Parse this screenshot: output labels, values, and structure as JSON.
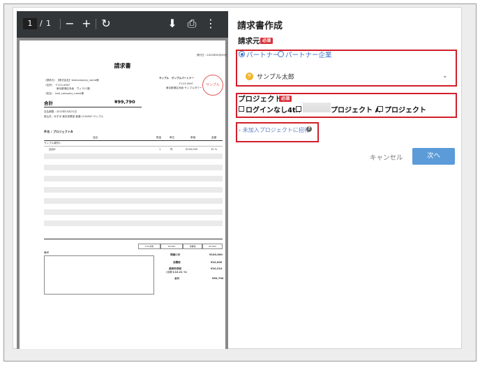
{
  "viewer": {
    "current_page": "1",
    "page_separator": "/",
    "total_pages": "1",
    "zoom_out_icon": "−",
    "zoom_in_icon": "+",
    "rotate_icon": "↻",
    "download_icon": "⬇",
    "print_icon": "⎙",
    "more_icon": "⋮"
  },
  "pdf": {
    "title": "請求書",
    "issue_date": "発行日 : 2022年09月30日",
    "recipient_lines": [
      "（請求元）　【株式会社】testcompany_name様",
      "（住所）　〒123-4567",
      "　　　　　東京都港区赤坂　ヴィラ11階",
      "（宛名）　test_company_name様"
    ],
    "sender_name": "サンプル　サンプルパートナー",
    "sender_lines": [
      "〒123-4567",
      "東京都港区赤坂 サンプルタワー"
    ],
    "seal_text": "サンプル",
    "total_label": "合計",
    "total_value": "¥99,790",
    "due_lines": [
      "支払期限 : 2022年10月31日",
      "振込先 : みずほ 東京営業部 普通 1234567 サンプル"
    ],
    "project_heading": "件名 : プロジェクトA",
    "table_headers": [
      "品目",
      "数量",
      "単位",
      "単価",
      "金額"
    ],
    "table_group": "サンプル案件1",
    "first_row": [
      "品目A",
      "1",
      "件",
      "¥100,000",
      "10 %"
    ],
    "tax_table": [
      "10%対象",
      "¥9,990",
      "消費税",
      "¥9,090"
    ],
    "notes_label": "備考",
    "summary_labels": [
      "明細小計",
      "消費税",
      "源泉所得税",
      "（小計＊10.21 %）",
      "合計"
    ],
    "summary_values": [
      "¥100,000",
      "¥10,000",
      "¥10,210",
      "",
      "¥99,790"
    ]
  },
  "form": {
    "title": "請求書作成",
    "billing_from_label": "請求元",
    "required_badge": "必須",
    "radio_partner": "パートナー",
    "radio_partner_company": "パートナー企業",
    "partner_avatar_initial": "サ",
    "partner_selected": "サンプル太郎",
    "project_label": "プロジェクト",
    "project_opt1": "ログインなし4th",
    "project_opt3": "プロジェクト A",
    "project_opt4": "プロジェクト",
    "invite_link": "未加入プロジェクトに招待",
    "help_icon": "?",
    "cancel_label": "キャンセル",
    "next_label": "次へ"
  }
}
